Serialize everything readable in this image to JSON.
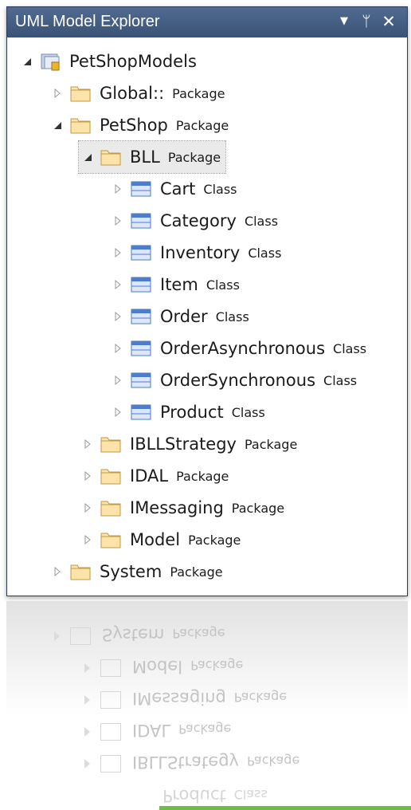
{
  "window": {
    "title": "UML Model Explorer",
    "dropdown_icon": "▼",
    "pin_icon": "ᛘ",
    "close_icon": "✕"
  },
  "colors": {
    "titlebar": "#3f5780",
    "folder_fill": "#fce3a9",
    "folder_stroke": "#c19a4a",
    "class_fill": "#dbe7fb",
    "class_stroke": "#4f7ec9",
    "selection": "#eaeaea"
  },
  "tree": {
    "root": {
      "name": "PetShopModels",
      "icon": "model-icon"
    },
    "global": {
      "name": "Global::",
      "kind": "Package"
    },
    "petshop": {
      "name": "PetShop",
      "kind": "Package"
    },
    "bll": {
      "name": "BLL",
      "kind": "Package"
    },
    "bll_classes": [
      {
        "name": "Cart",
        "kind": "Class"
      },
      {
        "name": "Category",
        "kind": "Class"
      },
      {
        "name": "Inventory",
        "kind": "Class"
      },
      {
        "name": "Item",
        "kind": "Class"
      },
      {
        "name": "Order",
        "kind": "Class"
      },
      {
        "name": "OrderAsynchronous",
        "kind": "Class"
      },
      {
        "name": "OrderSynchronous",
        "kind": "Class"
      },
      {
        "name": "Product",
        "kind": "Class"
      }
    ],
    "petshop_packages": [
      {
        "name": "IBLLStrategy",
        "kind": "Package"
      },
      {
        "name": "IDAL",
        "kind": "Package"
      },
      {
        "name": "IMessaging",
        "kind": "Package"
      },
      {
        "name": "Model",
        "kind": "Package"
      }
    ],
    "system": {
      "name": "System",
      "kind": "Package"
    }
  },
  "reflection": [
    {
      "name": "System",
      "kind": "Package"
    },
    {
      "name": "Model",
      "kind": "Package"
    },
    {
      "name": "IMessaging",
      "kind": "Package"
    },
    {
      "name": "IDAL",
      "kind": "Package"
    },
    {
      "name": "IBLLStrategy",
      "kind": "Package"
    },
    {
      "name": "Product",
      "kind": "Class"
    }
  ]
}
